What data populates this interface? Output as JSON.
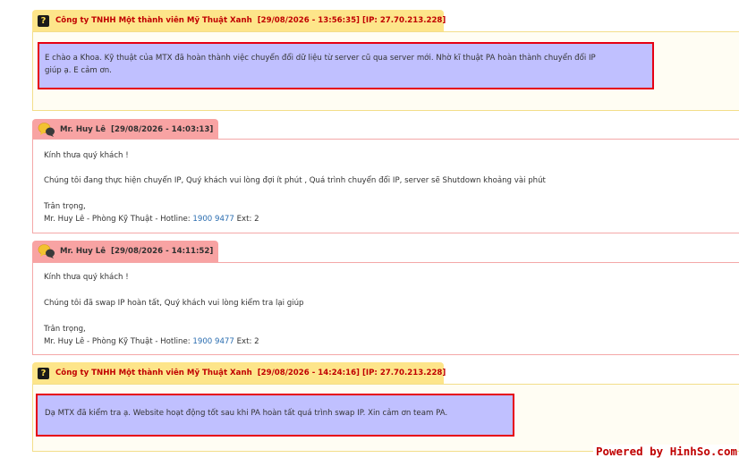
{
  "messages": [
    {
      "author": "Công ty TNHH Một thành viên Mỹ Thuật Xanh",
      "meta": "[29/08/2026 - 13:56:35] [IP: 27.70.213.228]",
      "lines": [
        "E chào a Khoa. Kỹ thuật của MTX đã hoàn thành việc chuyển đổi dữ liệu từ server cũ qua server mới. Nhờ kĩ thuật PA hoàn thành chuyển đổi IP",
        "giúp ạ. E cảm ơn."
      ]
    },
    {
      "author": "Mr. Huy Lê",
      "meta": "[29/08/2026 - 14:03:13]",
      "greeting": "Kính thưa quý khách !",
      "text": "Chúng tôi đang thực hiện chuyển IP, Quý khách vui lòng đợi ít phút , Quá trình chuyển đổi IP, server sẽ Shutdown khoảng vài phút",
      "closing": "Trân trọng,",
      "signature": "Mr. Huy Lê - Phòng Kỹ Thuật - Hotline: ",
      "hotline": "1900 9477",
      "ext": " Ext: 2"
    },
    {
      "author": "Mr. Huy Lê",
      "meta": "[29/08/2026 - 14:11:52]",
      "greeting": "Kính thưa quý khách !",
      "text": "Chúng tôi đã swap IP hoàn tất, Quý khách vui lòng kiểm tra lại giúp",
      "closing": "Trân trọng,",
      "signature": "Mr. Huy Lê - Phòng Kỹ Thuật - Hotline: ",
      "hotline": "1900 9477",
      "ext": " Ext: 2"
    },
    {
      "author": "Công ty TNHH Một thành viên Mỹ Thuật Xanh",
      "meta": "[29/08/2026 - 14:24:16] [IP: 27.70.213.228]",
      "lines": [
        "Dạ MTX đã kiểm tra ạ. Website hoạt động tốt sau khi PA hoàn tất quá trình swap IP. Xin cảm ơn team PA."
      ]
    }
  ],
  "icons": {
    "customer": "question-icon",
    "staff": "chat-bubbles-icon"
  },
  "watermark": "Powered by HinhSo.com"
}
